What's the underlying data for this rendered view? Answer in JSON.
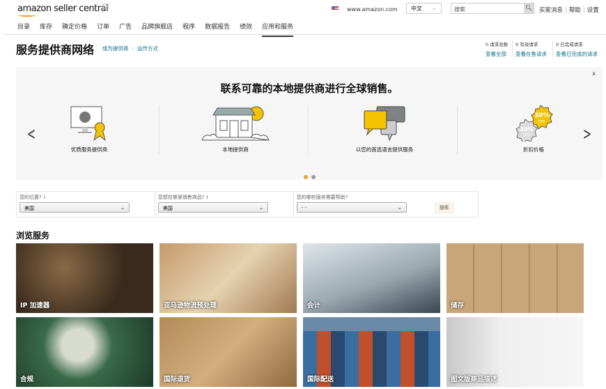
{
  "header": {
    "logo": "amazon seller central",
    "site": "www.amazon.com",
    "language": "中文",
    "search_placeholder": "搜索",
    "links": [
      "买家消息",
      "帮助",
      "设置"
    ]
  },
  "nav": [
    "目录",
    "库存",
    "确定价格",
    "订单",
    "广告",
    "品牌旗舰店",
    "程序",
    "数据报告",
    "绩效",
    "应用和服务"
  ],
  "page": {
    "title": "服务提供商网络",
    "links": [
      "成为提供商",
      "运作方式"
    ]
  },
  "stats": [
    {
      "count": "0 请求总数",
      "link": "查看全部"
    },
    {
      "count": "0 有效请求",
      "link": "查看在售请求"
    },
    {
      "count": "0 已完成请求",
      "link": "查看已完成的请求"
    }
  ],
  "banner": {
    "title": "联系可靠的本地提供商进行全球销售。",
    "close": "x",
    "features": [
      "优质服务提供商",
      "本地提供商",
      "以您的首选语言提供服务",
      "折扣价格"
    ],
    "badges": [
      "30%",
      "OFF",
      "20%",
      "OFF"
    ],
    "active_slide": 1,
    "slides": 2
  },
  "filters": [
    {
      "label": "您的位置?",
      "value": "美国",
      "info": "i"
    },
    {
      "label": "您想在哪里销售商品?",
      "value": "美国",
      "info": "i"
    },
    {
      "label": "您的哪些服务需要帮助?",
      "value": "- -"
    }
  ],
  "filter_button": "搜索",
  "browse": {
    "heading": "浏览服务",
    "tiles": [
      "IP 加速器",
      "亚马逊物流预处理",
      "会计",
      "储存",
      "合规",
      "国际退货",
      "国际配送",
      "图文版商品描述"
    ]
  },
  "colors": {
    "accent": "#f0a030",
    "link": "#0a6e8a"
  }
}
